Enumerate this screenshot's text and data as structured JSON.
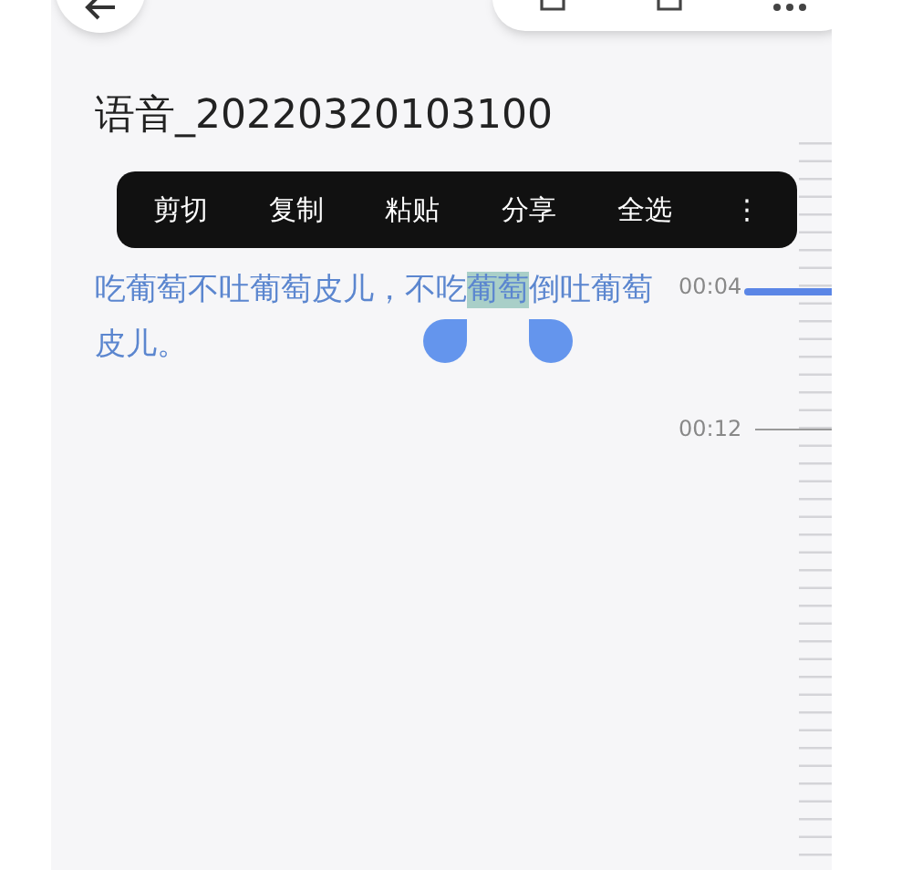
{
  "title": "语音_20220320103100",
  "context_menu": {
    "items": [
      {
        "label": "剪切"
      },
      {
        "label": "复制"
      },
      {
        "label": "粘贴"
      },
      {
        "label": "分享"
      },
      {
        "label": "全选"
      },
      {
        "label": "⋮"
      }
    ]
  },
  "transcript": {
    "segments": [
      {
        "text": "吃葡萄不吐葡萄皮儿，不吃",
        "selected": false
      },
      {
        "text": "葡萄",
        "selected": true
      },
      {
        "text": "倒吐葡萄皮儿。",
        "selected": false
      }
    ]
  },
  "timeline": {
    "marks": [
      {
        "label": "00:04",
        "current": true
      },
      {
        "label": "00:12",
        "current": false
      }
    ]
  }
}
